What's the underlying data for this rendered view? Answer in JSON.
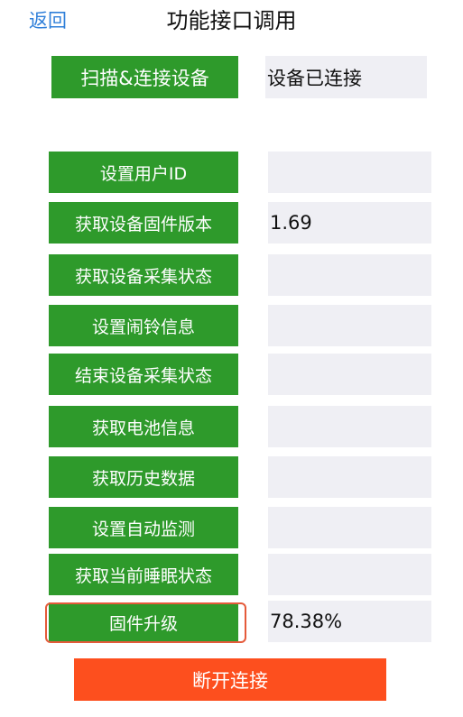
{
  "nav": {
    "back_label": "返回",
    "title": "功能接口调用"
  },
  "connect": {
    "button_label": "扫描&连接设备",
    "status": "设备已连接"
  },
  "functions": [
    {
      "label": "设置用户ID",
      "value": ""
    },
    {
      "label": "获取设备固件版本",
      "value": "1.69"
    },
    {
      "label": "获取设备采集状态",
      "value": ""
    },
    {
      "label": "设置闹铃信息",
      "value": ""
    },
    {
      "label": "结束设备采集状态",
      "value": ""
    },
    {
      "label": "获取电池信息",
      "value": ""
    },
    {
      "label": "获取历史数据",
      "value": ""
    },
    {
      "label": "设置自动监测",
      "value": ""
    },
    {
      "label": "获取当前睡眠状态",
      "value": ""
    },
    {
      "label": "固件升级",
      "value": "78.38%"
    }
  ],
  "disconnect": {
    "button_label": "断开连接"
  },
  "colors": {
    "button_green": "#2e9a2b",
    "field_gray": "#efeff4",
    "disconnect_orange": "#fd4f1e",
    "nav_blue": "#2f7fd9",
    "highlight_red": "#e55a3a"
  }
}
